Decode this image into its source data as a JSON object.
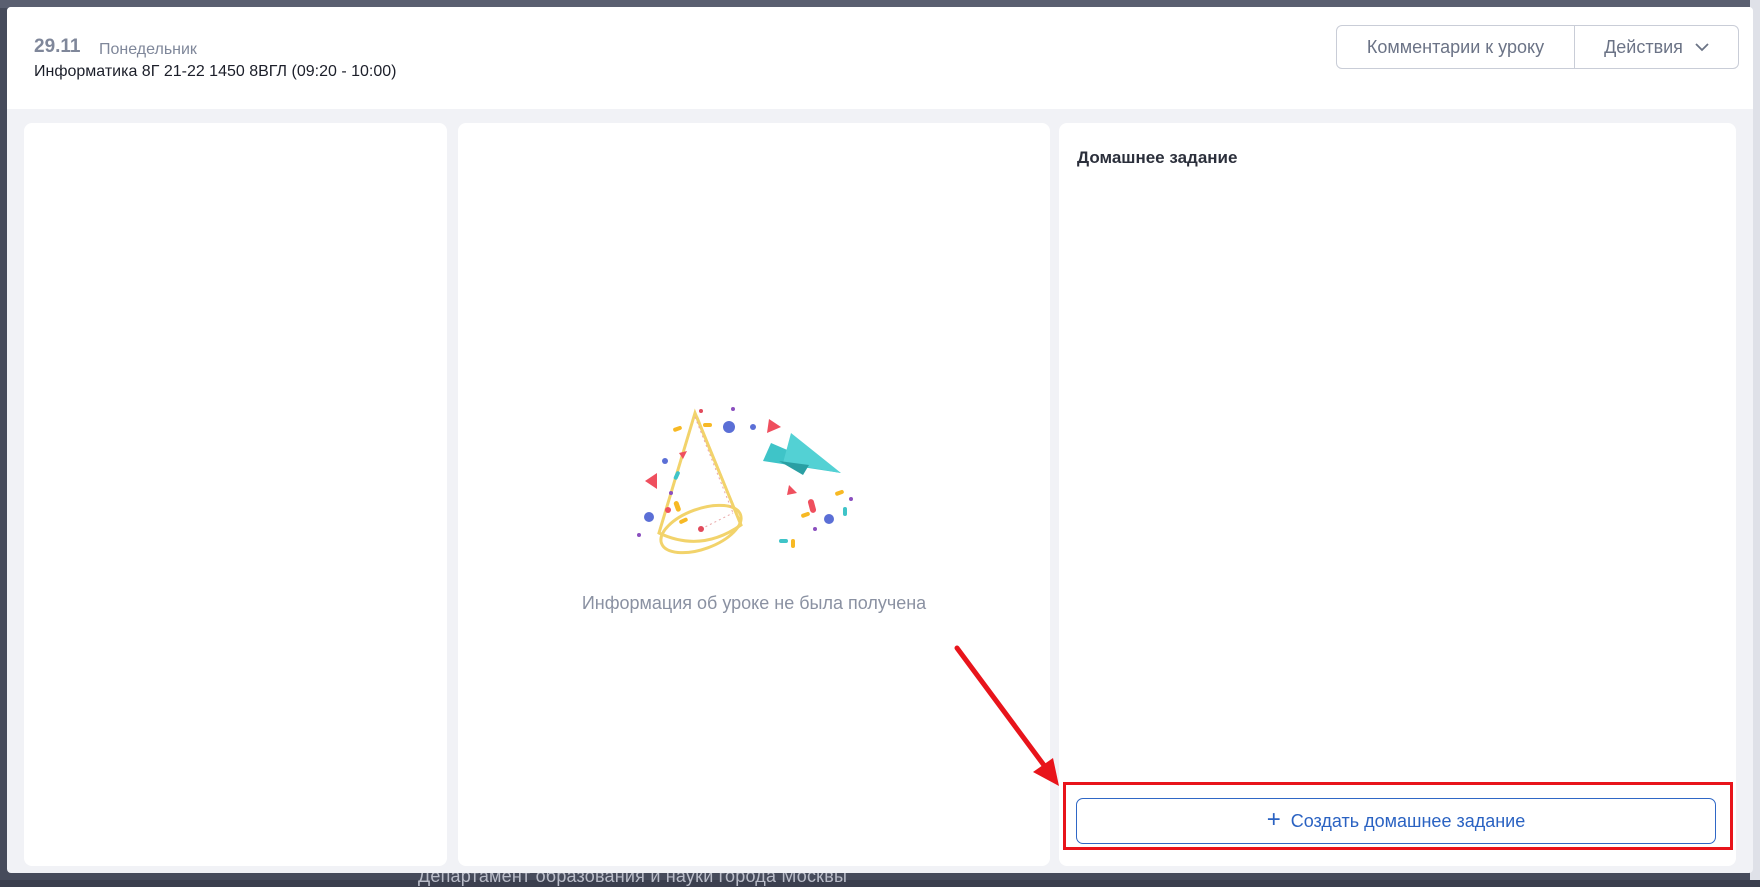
{
  "background": {
    "footer_text": "Департамент образования и науки города Москвы"
  },
  "header": {
    "date": "29.11",
    "weekday": "Понедельник",
    "lesson": "Информатика 8Г 21-22 1450 8ВГЛ (09:20 - 10:00)",
    "comments_button": "Комментарии к уроку",
    "actions_button": "Действия"
  },
  "center_panel": {
    "empty_message": "Информация об уроке не была получена",
    "illustration_icon": "party-cone-paper-plane-icon"
  },
  "homework_panel": {
    "title": "Домашнее задание",
    "create_button": "Создать домашнее задание"
  },
  "annotation": {
    "highlight_color": "#e8141b"
  },
  "colors": {
    "accent": "#2a62c2",
    "muted_text": "#8a91a2"
  }
}
